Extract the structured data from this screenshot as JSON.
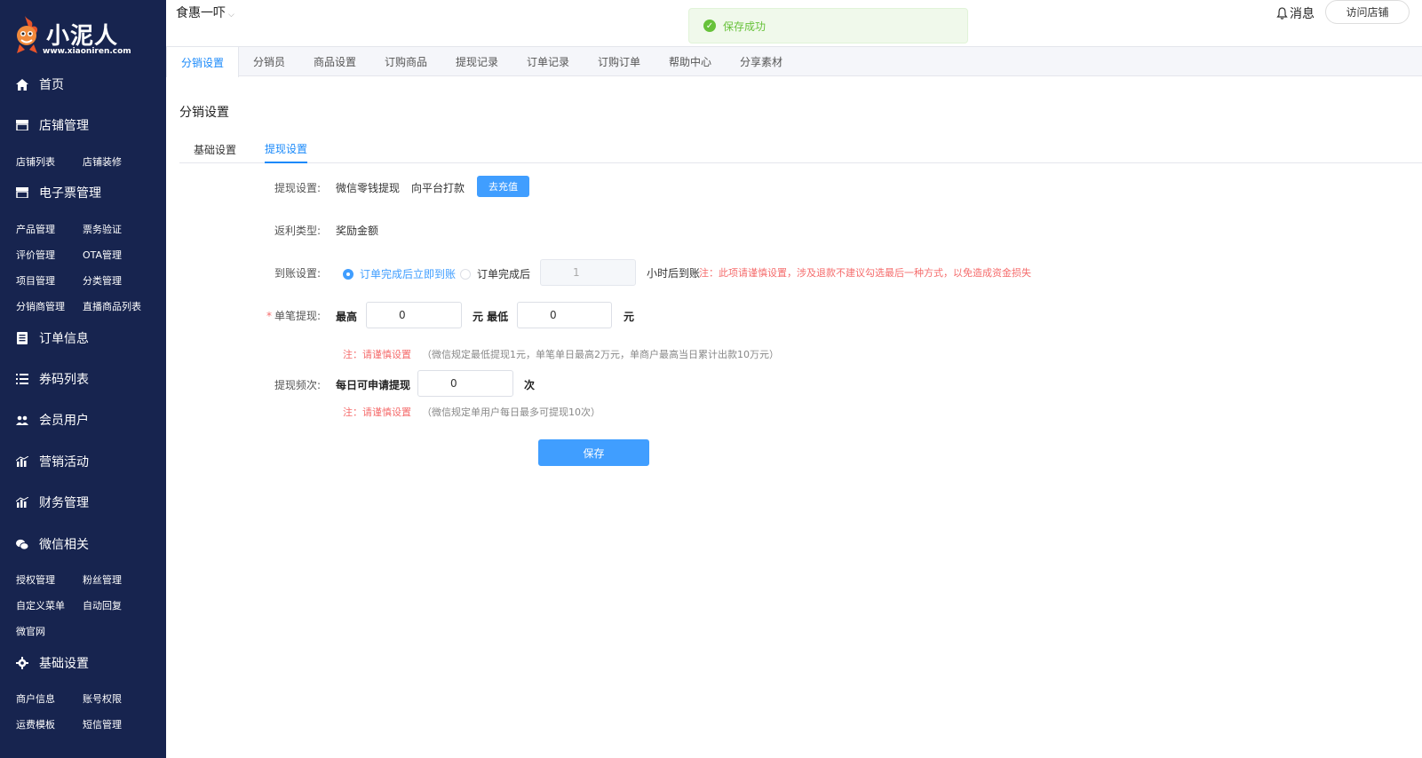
{
  "sidebar": {
    "brand": "小泥人",
    "brand_url": "www.xiaoniren.com",
    "home": "首页",
    "store_mgmt": "店铺管理",
    "store_list": "店铺列表",
    "store_decor": "店铺装修",
    "eticket_mgmt": "电子票管理",
    "product_mgmt": "产品管理",
    "ticket_verify": "票务验证",
    "review_mgmt": "评价管理",
    "ota_mgmt": "OTA管理",
    "project_mgmt": "项目管理",
    "category_mgmt": "分类管理",
    "distributor_mgmt": "分销商管理",
    "live_list": "直播商品列表",
    "order_info": "订单信息",
    "coupon_list": "券码列表",
    "members": "会员用户",
    "marketing": "营销活动",
    "finance": "财务管理",
    "wechat": "微信相关",
    "auth_mgmt": "授权管理",
    "fans_mgmt": "粉丝管理",
    "custom_menu": "自定义菜单",
    "auto_reply": "自动回复",
    "micro_site": "微官网",
    "basic_settings": "基础设置",
    "merchant_info": "商户信息",
    "account_perm": "账号权限",
    "freight_tpl": "运费模板",
    "sms_mgmt": "短信管理"
  },
  "topbar": {
    "store_name": "食惠一吓",
    "toast": "保存成功",
    "messages": "消息",
    "visit_store": "访问店铺"
  },
  "tabs": [
    "分销设置",
    "分销员",
    "商品设置",
    "订购商品",
    "提现记录",
    "订单记录",
    "订购订单",
    "帮助中心",
    "分享素材"
  ],
  "main": {
    "title": "分销设置",
    "subtabs": [
      "基础设置",
      "提现设置"
    ],
    "withdraw_label": "提现设置:",
    "withdraw_opt1": "微信零钱提现",
    "withdraw_opt2": "向平台打款",
    "recharge_btn": "去充值",
    "rebate_label": "返利类型:",
    "rebate_value": "奖励金额",
    "arrival_label": "到账设置:",
    "arrival_opt1": "订单完成后立即到账",
    "arrival_opt2": "订单完成后",
    "arrival_hours": "1",
    "arrival_suffix": "小时后到账",
    "arrival_note": "注：此项请谨慎设置，涉及退款不建议勾选最后一种方式，以免造成资金损失",
    "single_label": "单笔提现:",
    "max_label": "最高",
    "max_value": "0",
    "yuan_min_label": "元 最低",
    "min_value": "0",
    "yuan": "元",
    "note_prefix": "注：请谨慎设置",
    "single_hint": "（微信规定最低提现1元，单笔单日最高2万元，单商户最高当日累计出款10万元）",
    "freq_label": "提现频次:",
    "daily_label": "每日可申请提现",
    "daily_value": "0",
    "times": "次",
    "freq_hint": "（微信规定单用户每日最多可提现10次）",
    "save_btn": "保存"
  },
  "colors": {
    "sidebar": "#17244f",
    "primary": "#409eff",
    "success": "#67c23a",
    "danger": "#f56c6c"
  }
}
